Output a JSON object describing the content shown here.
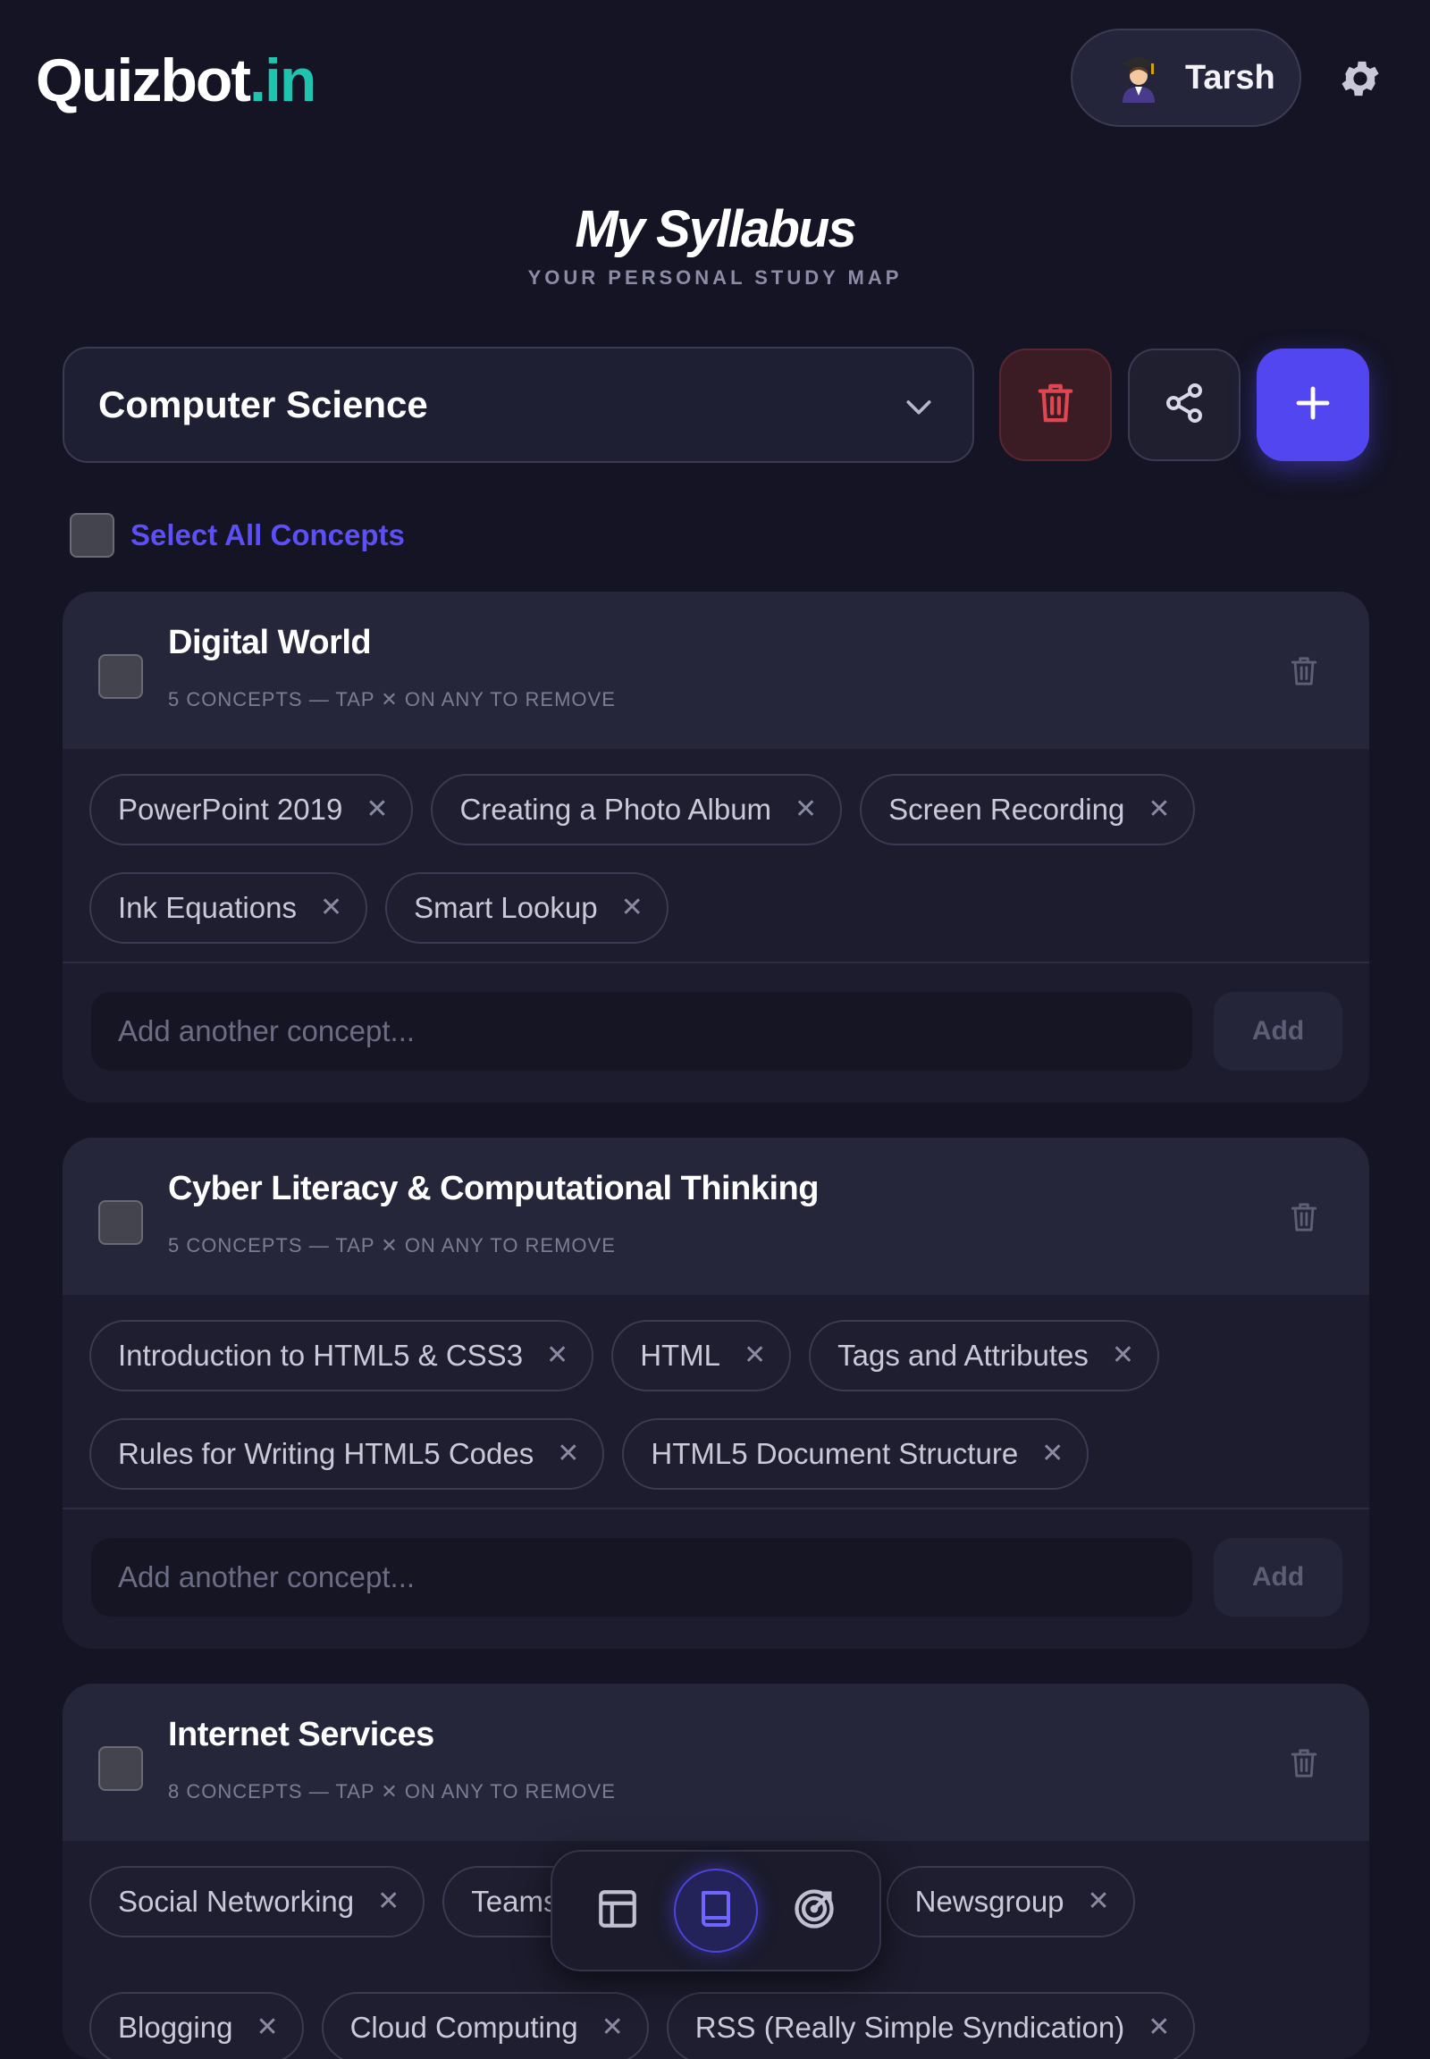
{
  "header": {
    "logo_main": "Quizbot",
    "logo_domain": ".in",
    "user_name": "Tarsh"
  },
  "page": {
    "title": "My Syllabus",
    "subtitle": "YOUR PERSONAL STUDY MAP"
  },
  "toolbar": {
    "subject": "Computer Science"
  },
  "select_all_label": "Select All Concepts",
  "topics": [
    {
      "title": "Digital World",
      "meta": "5 CONCEPTS — TAP ✕ ON ANY TO REMOVE",
      "concepts": [
        "PowerPoint 2019",
        "Creating a Photo Album",
        "Screen Recording",
        "Ink Equations",
        "Smart Lookup"
      ],
      "input_placeholder": "Add another concept...",
      "add_label": "Add"
    },
    {
      "title": "Cyber Literacy & Computational Thinking",
      "meta": "5 CONCEPTS — TAP ✕ ON ANY TO REMOVE",
      "concepts": [
        "Introduction to HTML5 & CSS3",
        "HTML",
        "Tags and Attributes",
        "Rules for Writing HTML5 Codes",
        "HTML5 Document Structure"
      ],
      "input_placeholder": "Add another concept...",
      "add_label": "Add"
    },
    {
      "title": "Internet Services",
      "meta": "8 CONCEPTS — TAP ✕ ON ANY TO REMOVE",
      "concepts": [
        "Social Networking",
        "Teams",
        "Newsgroup",
        "Blogging",
        "Cloud Computing",
        "RSS (Really Simple Syndication)"
      ],
      "input_placeholder": "Add another concept...",
      "add_label": "Add"
    }
  ],
  "chip_remove_glyph": "✕",
  "colors": {
    "background": "#141424",
    "accent": "#5146f0",
    "brand_teal": "#1fc4ae",
    "danger": "#e0464f"
  },
  "icons": {
    "user_avatar": "graduate-avatar-icon",
    "settings": "gear-icon",
    "dropdown": "chevron-down-icon",
    "delete": "trash-icon",
    "share": "share-icon",
    "add": "plus-icon",
    "nav_left": "layout-icon",
    "nav_center": "book-icon",
    "nav_right": "target-icon"
  }
}
